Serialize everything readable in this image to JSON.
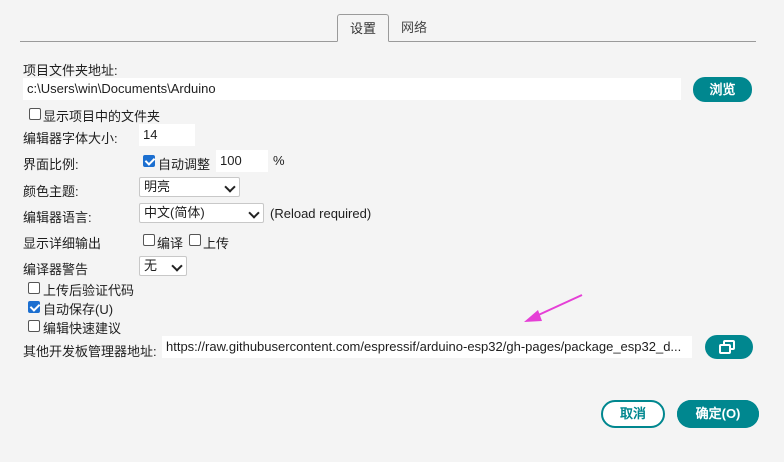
{
  "tabs": [
    {
      "label": "设置",
      "active": true
    },
    {
      "label": "网络",
      "active": false
    }
  ],
  "sketchbook": {
    "label": "项目文件夹地址:",
    "path": "c:\\Users\\win\\Documents\\Arduino",
    "browse_label": "浏览"
  },
  "show_files": {
    "label": "显示项目中的文件夹",
    "checked": false
  },
  "font_size": {
    "label": "编辑器字体大小:",
    "value": "14"
  },
  "scale": {
    "label": "界面比例:",
    "auto_label": "自动调整",
    "auto_checked": true,
    "value": "100",
    "unit": "%"
  },
  "theme": {
    "label": "颜色主题:",
    "value": "明亮"
  },
  "language": {
    "label": "编辑器语言:",
    "value": "中文(简体)",
    "note": "(Reload required)"
  },
  "verbose": {
    "label": "显示详细输出",
    "compile_label": "编译",
    "upload_label": "上传",
    "compile_checked": false,
    "upload_checked": false
  },
  "warnings": {
    "label": "编译器警告",
    "value": "无"
  },
  "verify_after_upload": {
    "label": "上传后验证代码",
    "checked": false
  },
  "autosave": {
    "label": "自动保存(U)",
    "checked": true
  },
  "quick_suggestions": {
    "label": "编辑快速建议",
    "checked": false
  },
  "board_urls": {
    "label": "其他开发板管理器地址:",
    "value": "https://raw.githubusercontent.com/espressif/arduino-esp32/gh-pages/package_esp32_d..."
  },
  "footer": {
    "cancel_label": "取消",
    "ok_label": "确定(O)"
  },
  "colors": {
    "accent": "#00878f",
    "annotation_arrow": "#e53fd6",
    "checkbox": "#1c6fd0"
  }
}
